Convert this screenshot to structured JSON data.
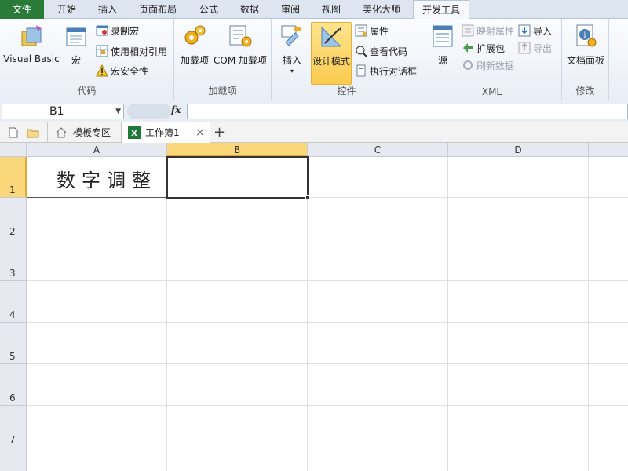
{
  "ribbon_tabs": [
    {
      "label": "文件"
    },
    {
      "label": "开始"
    },
    {
      "label": "插入"
    },
    {
      "label": "页面布局"
    },
    {
      "label": "公式"
    },
    {
      "label": "数据"
    },
    {
      "label": "审阅"
    },
    {
      "label": "视图"
    },
    {
      "label": "美化大师"
    },
    {
      "label": "开发工具"
    }
  ],
  "groups": {
    "code": {
      "label": "代码",
      "visual_basic": "Visual Basic",
      "macro": "宏",
      "record_macro": "录制宏",
      "relative_ref": "使用相对引用",
      "macro_security": "宏安全性"
    },
    "addins": {
      "label": "加载项",
      "addins": "加载项",
      "com_addins": "COM 加载项"
    },
    "controls": {
      "label": "控件",
      "insert": "插入",
      "design_mode": "设计模式",
      "properties": "属性",
      "view_code": "查看代码",
      "run_dialog": "执行对话框"
    },
    "xml": {
      "label": "XML",
      "source": "源",
      "map_props": "映射属性",
      "expansion": "扩展包",
      "refresh": "刷新数据",
      "import": "导入",
      "export": "导出"
    },
    "modify": {
      "label": "修改",
      "doc_panel": "文档面板"
    }
  },
  "formula_bar": {
    "name_box": "B1",
    "fx": "fx",
    "value": ""
  },
  "workbook_tabs": {
    "template_zone": "模板专区",
    "workbook": "工作簿1",
    "close": "×",
    "add": "+"
  },
  "columns": [
    "A",
    "B",
    "C",
    "D"
  ],
  "rows": [
    "1",
    "2",
    "3",
    "4",
    "5",
    "6",
    "7"
  ],
  "cells": {
    "A1": "数字调整"
  },
  "colors": {
    "file_tab": "#2a7b39",
    "selected_header": "#f9d77a",
    "highlight": "#fbcb4e"
  }
}
